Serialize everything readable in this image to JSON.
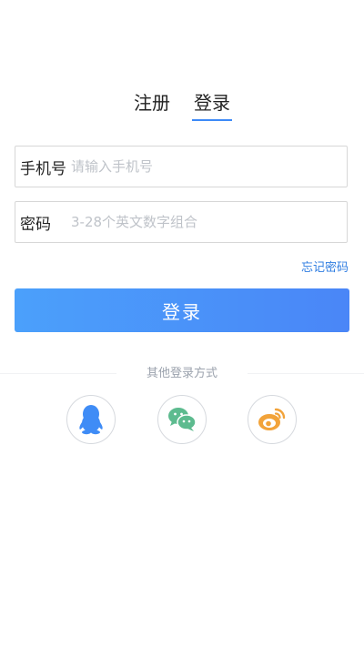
{
  "tabs": [
    {
      "label": "注册",
      "active": false
    },
    {
      "label": "登录",
      "active": true
    }
  ],
  "phone_field": {
    "label": "手机号",
    "value": "",
    "placeholder": "请输入手机号"
  },
  "password_field": {
    "label": "密码",
    "value": "",
    "placeholder": "3-28个英文数字组合"
  },
  "forgot_password": "忘记密码",
  "login_button": "登录",
  "other_login": {
    "label": "其他登录方式",
    "providers": [
      {
        "icon": "qq-icon",
        "color": "#3f8cf6"
      },
      {
        "icon": "wechat-icon",
        "color": "#5dbb8f"
      },
      {
        "icon": "weibo-icon",
        "color": "#f2a33a"
      }
    ]
  },
  "colors": {
    "accent": "#3d8af7",
    "link": "#2f7de1",
    "button_gradient_start": "#4ba0fb",
    "button_gradient_end": "#4a86f7"
  }
}
